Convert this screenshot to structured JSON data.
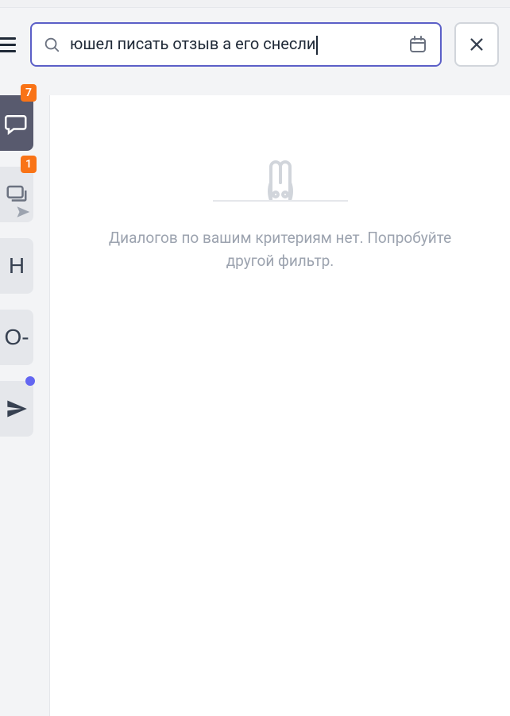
{
  "search": {
    "visible_text": "юшел писать отзыв а его снесли"
  },
  "sidebar": {
    "tiles": [
      {
        "name": "chat",
        "badge": "7"
      },
      {
        "name": "chats-stack",
        "badge": "1"
      },
      {
        "name": "letter-h",
        "label": "Н"
      },
      {
        "name": "letter-o",
        "label": "О-"
      },
      {
        "name": "send"
      }
    ]
  },
  "empty_state": {
    "message": "Диалогов по вашим критериям нет. Попробуйте другой фильтр."
  }
}
